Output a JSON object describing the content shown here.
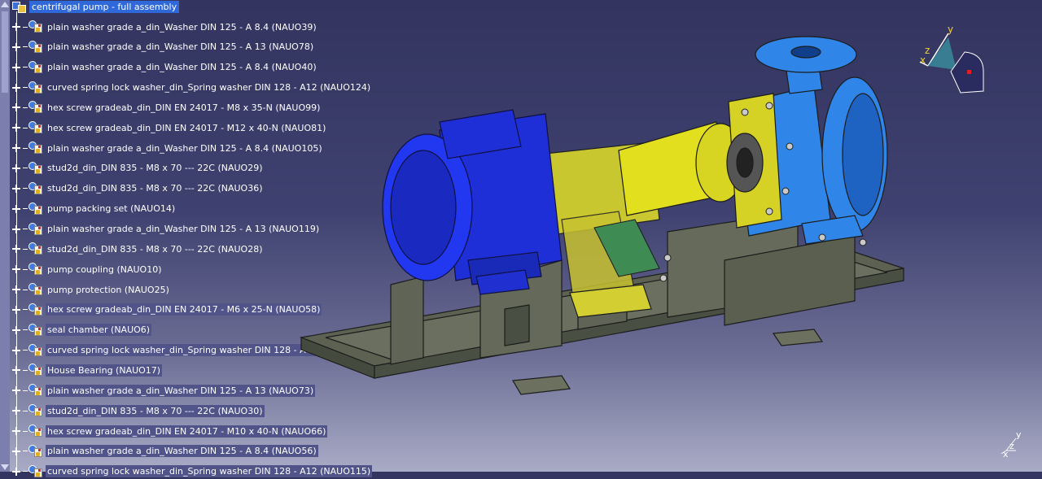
{
  "tree": {
    "root_label": "centrifugal pump - full assembly",
    "items": [
      {
        "label": "plain washer grade a_din_Washer DIN 125 - A 8.4 (NAUO39)",
        "selected": false
      },
      {
        "label": "plain washer grade a_din_Washer DIN 125 - A 13 (NAUO78)",
        "selected": false
      },
      {
        "label": "plain washer grade a_din_Washer DIN 125 - A 8.4 (NAUO40)",
        "selected": false
      },
      {
        "label": "curved spring lock washer_din_Spring washer DIN 128 - A12 (NAUO124)",
        "selected": false
      },
      {
        "label": "hex screw gradeab_din_DIN EN 24017 - M8 x 35-N (NAUO99)",
        "selected": false
      },
      {
        "label": "hex screw gradeab_din_DIN EN 24017 - M12 x 40-N (NAUO81)",
        "selected": false
      },
      {
        "label": "plain washer grade a_din_Washer DIN 125 - A 8.4 (NAUO105)",
        "selected": false
      },
      {
        "label": "stud2d_din_DIN 835 - M8  x  70 --- 22C (NAUO29)",
        "selected": false
      },
      {
        "label": "stud2d_din_DIN 835 - M8  x  70 --- 22C (NAUO36)",
        "selected": false
      },
      {
        "label": "pump packing set (NAUO14)",
        "selected": false
      },
      {
        "label": "plain washer grade a_din_Washer DIN 125 - A 13 (NAUO119)",
        "selected": false
      },
      {
        "label": "stud2d_din_DIN 835 - M8  x  70 --- 22C (NAUO28)",
        "selected": false
      },
      {
        "label": "pump coupling (NAUO10)",
        "selected": false
      },
      {
        "label": "pump protection (NAUO25)",
        "selected": false
      },
      {
        "label": "hex screw gradeab_din_DIN EN 24017 - M6 x 25-N (NAUO58)",
        "selected": true
      },
      {
        "label": "seal chamber (NAUO6)",
        "selected": true
      },
      {
        "label": "curved spring lock washer_din_Spring washer DIN 128 - A8 (NAUO106)",
        "selected": true
      },
      {
        "label": "House Bearing (NAUO17)",
        "selected": true
      },
      {
        "label": "plain washer grade a_din_Washer DIN 125 - A 13 (NAUO73)",
        "selected": true
      },
      {
        "label": "stud2d_din_DIN 835 - M8  x  70 --- 22C (NAUO30)",
        "selected": true
      },
      {
        "label": "hex screw gradeab_din_DIN EN 24017 - M10 x 40-N (NAUO66)",
        "selected": true
      },
      {
        "label": "plain washer grade a_din_Washer DIN 125 - A 8.4 (NAUO56)",
        "selected": true
      },
      {
        "label": "curved spring lock washer_din_Spring washer DIN 128 - A12 (NAUO115)",
        "selected": true
      }
    ]
  },
  "compass": {
    "x_label": "x",
    "y_label": "y",
    "z_label": "z"
  },
  "triad": {
    "x_label": "x",
    "y_label": "y",
    "z_label": "z"
  },
  "colors": {
    "motor": "#1f2fd8",
    "guard": "#d9d62a",
    "pump_casing": "#2f86e8",
    "base_frame": "#5c6152",
    "selection": "#2f68d8"
  }
}
